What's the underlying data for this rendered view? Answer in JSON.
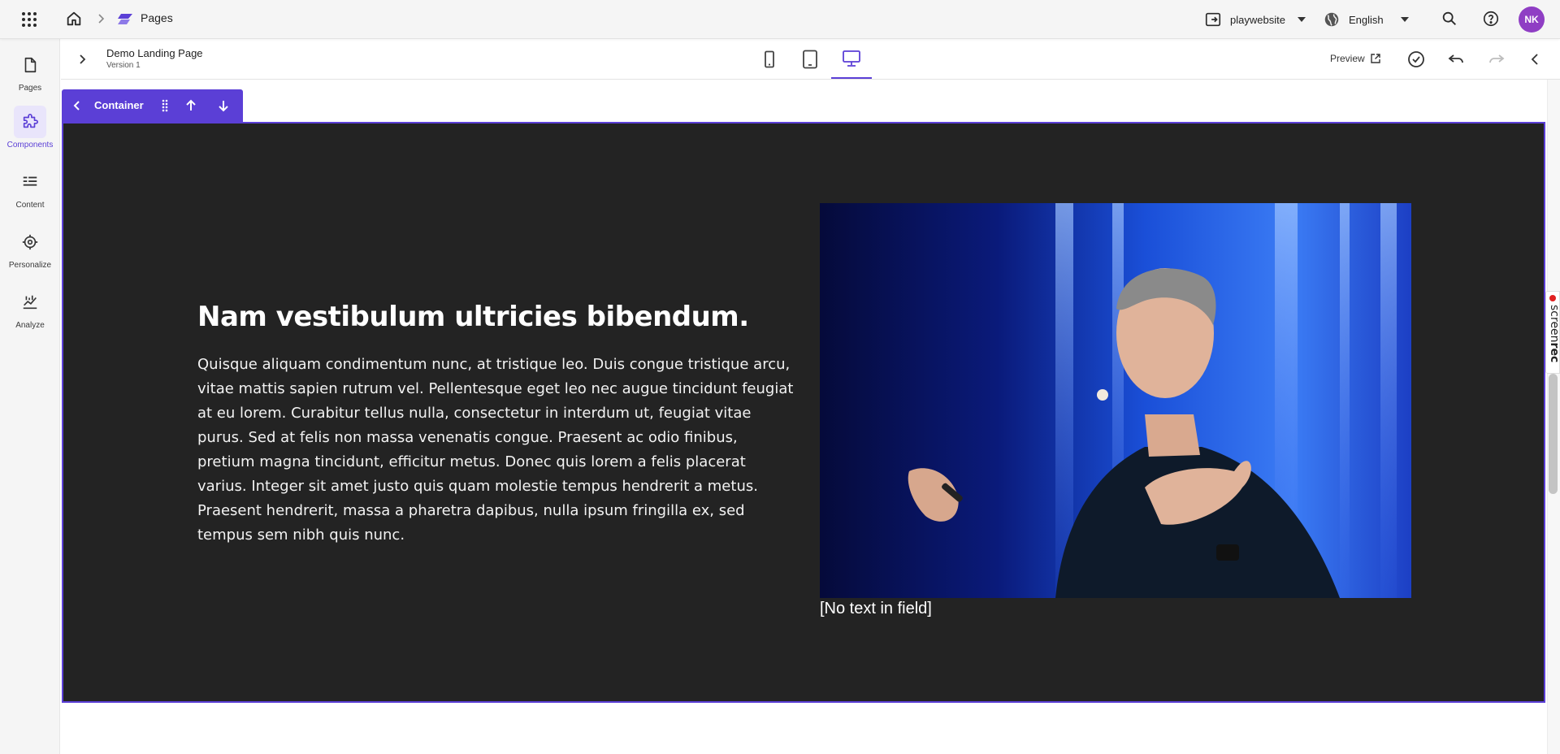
{
  "topbar": {
    "breadcrumb_label": "Pages",
    "site_label": "playwebsite",
    "language_label": "English",
    "avatar_initials": "NK",
    "accent": "#5b3fd6",
    "avatar_color": "#8f3ec4"
  },
  "rail": {
    "items": [
      {
        "label": "Pages",
        "icon": "page-icon"
      },
      {
        "label": "Components",
        "icon": "puzzle-icon",
        "active": true
      },
      {
        "label": "Content",
        "icon": "content-list-icon"
      },
      {
        "label": "Personalize",
        "icon": "target-icon"
      },
      {
        "label": "Analyze",
        "icon": "analytics-icon"
      }
    ]
  },
  "editor": {
    "page_title": "Demo Landing Page",
    "version": "Version 1",
    "devices": [
      "mobile-icon",
      "tablet-icon",
      "desktop-icon"
    ],
    "active_device": "desktop",
    "preview_label": "Preview"
  },
  "component_toolbar": {
    "name": "Container"
  },
  "hero": {
    "title": "Nam vestibulum ultricies bibendum.",
    "body": "Quisque aliquam condimentum nunc, at tristique leo. Duis congue tristique arcu, vitae mattis sapien rutrum vel. Pellentesque eget leo nec augue tincidunt feugiat at eu lorem. Curabitur tellus nulla, consectetur in interdum ut, feugiat vitae purus. Sed at felis non massa venenatis congue. Praesent ac odio finibus, pretium magna tincidunt, efficitur metus. Donec quis lorem a felis placerat varius. Integer sit amet justo quis quam molestie tempus hendrerit a metus. Praesent hendrerit, massa a pharetra dapibus, nulla ipsum fringilla ex, sed tempus sem nibh quis nunc.",
    "image_caption": "[No text in field]",
    "background": "#232323"
  },
  "screenrec": {
    "text_light": "screen",
    "text_bold": "rec"
  }
}
